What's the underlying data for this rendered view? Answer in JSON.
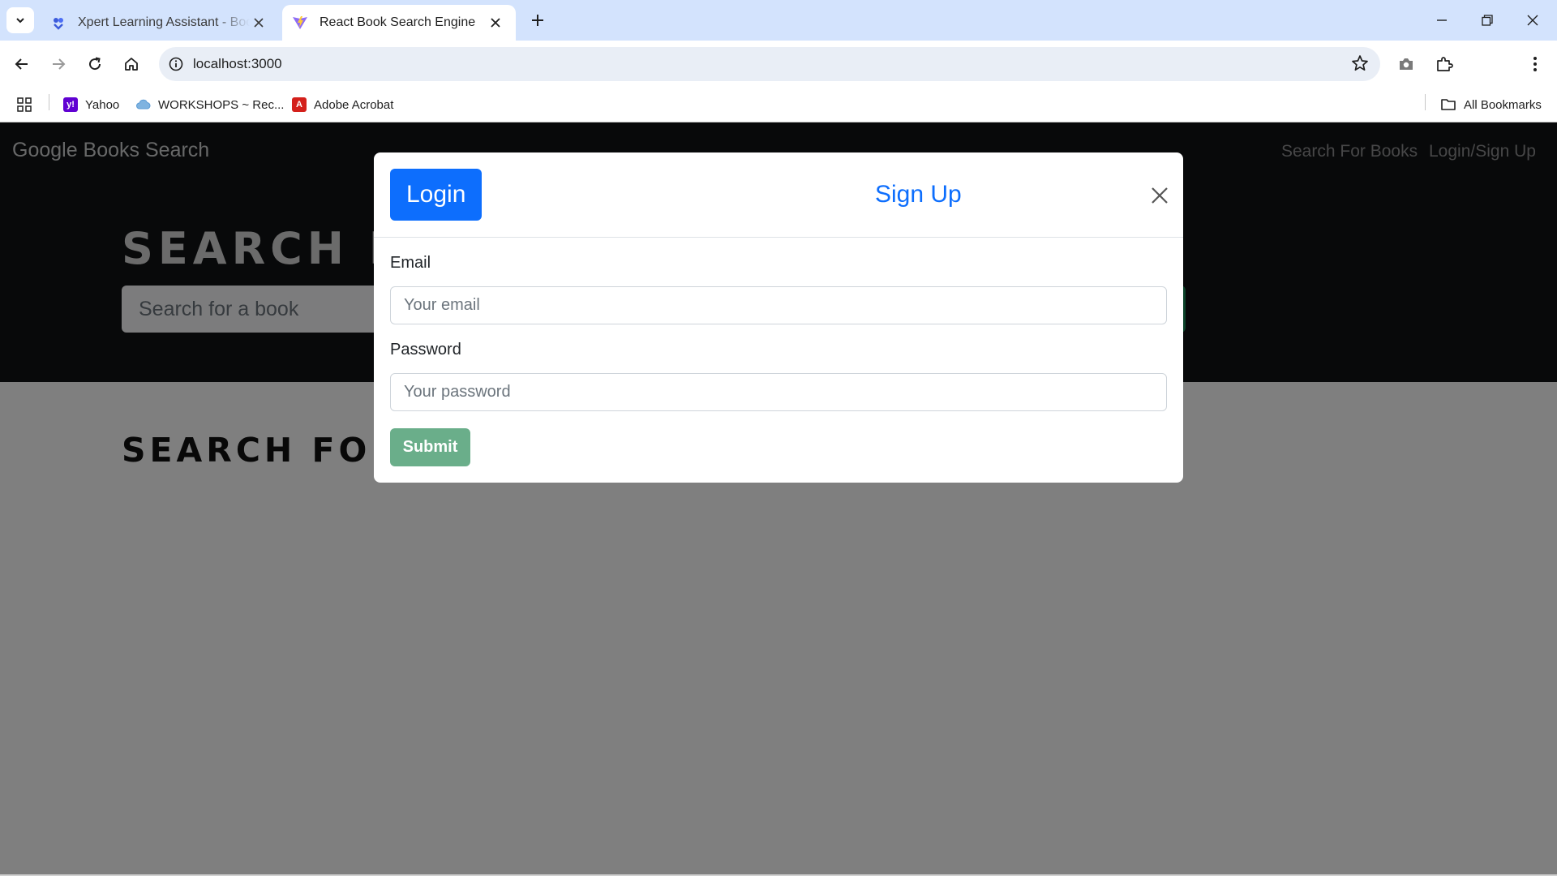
{
  "browser": {
    "tabs": [
      {
        "title": "Xpert Learning Assistant - Boot",
        "favicon": "xpert-icon",
        "active": false
      },
      {
        "title": "React Book Search Engine",
        "favicon": "vite-icon",
        "active": true
      }
    ],
    "url": "localhost:3000",
    "bookmarks": [
      {
        "label": "Yahoo",
        "icon": "yahoo-icon",
        "color": "#6001d2"
      },
      {
        "label": "WORKSHOPS ~ Rec...",
        "icon": "cloud-icon",
        "color": "#5b9bd5"
      },
      {
        "label": "Adobe Acrobat",
        "icon": "acrobat-icon",
        "color": "#d4201b"
      }
    ],
    "all_bookmarks_label": "All Bookmarks"
  },
  "app": {
    "brand": "Google Books Search",
    "nav": {
      "search_link": "Search For Books",
      "login_link": "Login/Sign Up"
    },
    "hero": {
      "title": "SEARCH FOR BOOKS!",
      "search_placeholder": "Search for a book"
    },
    "results": {
      "title": "SEARCH FOR A BOOK TO BEGIN"
    }
  },
  "modal": {
    "tabs": {
      "login": "Login",
      "signup": "Sign Up"
    },
    "active_tab": "login",
    "email_label": "Email",
    "email_placeholder": "Your email",
    "password_label": "Password",
    "password_placeholder": "Your password",
    "submit_label": "Submit"
  },
  "colors": {
    "primary": "#0d6efd",
    "success": "#198754",
    "navbar_bg": "#111214"
  }
}
